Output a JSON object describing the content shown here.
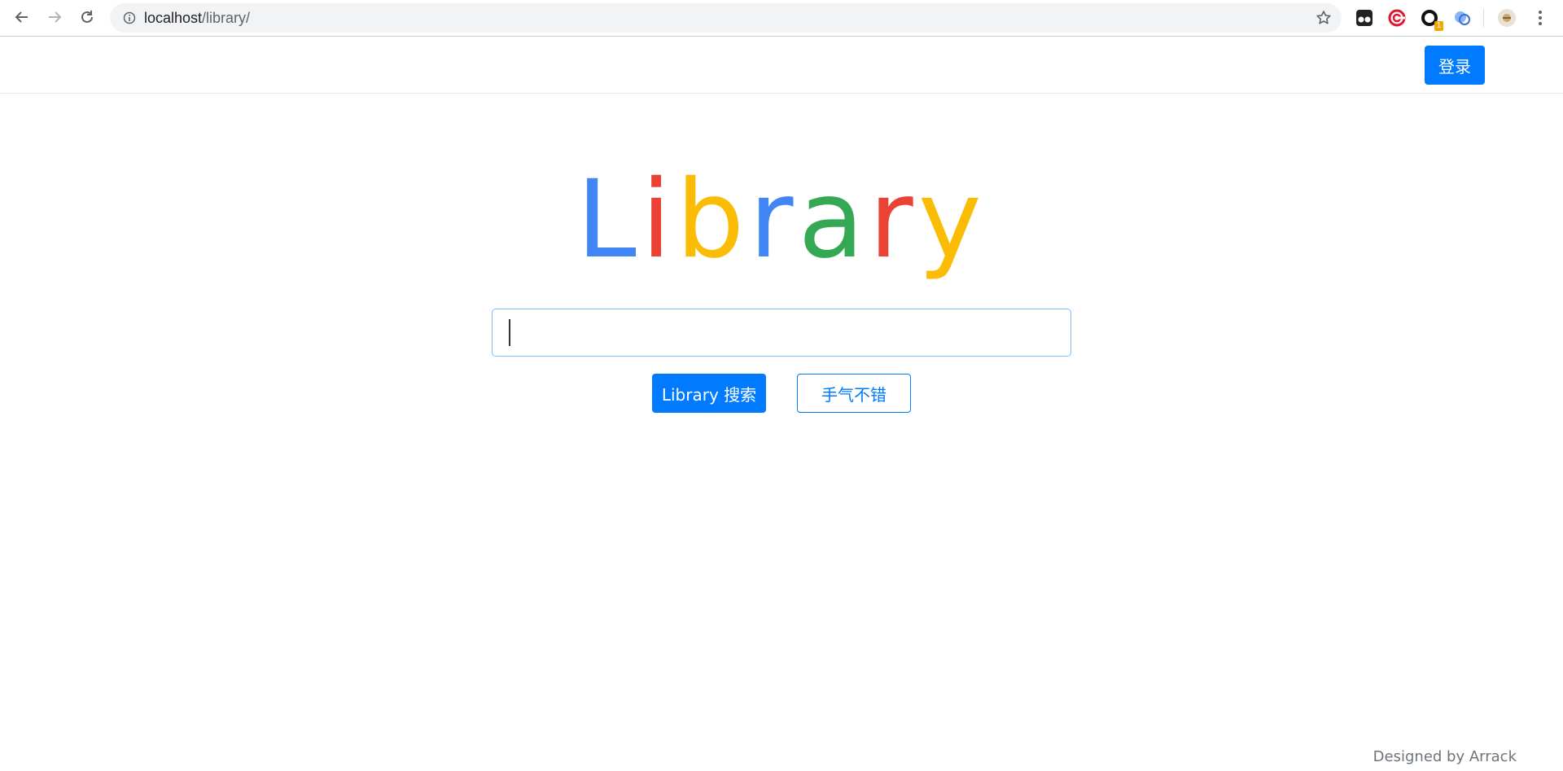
{
  "browser": {
    "url_host": "localhost",
    "url_path": "/library/",
    "extensions": [
      "tampermonkey-icon",
      "target-icon",
      "ring-icon",
      "translate-icon",
      "avatar-icon"
    ],
    "extension_badge": "1"
  },
  "navbar": {
    "login_label": "登录"
  },
  "logo": {
    "letters": [
      {
        "char": "L",
        "color": "#4285f4"
      },
      {
        "char": "i",
        "color": "#ea4335"
      },
      {
        "char": "b",
        "color": "#fbbc05"
      },
      {
        "char": "r",
        "color": "#4285f4"
      },
      {
        "char": "a",
        "color": "#34a853"
      },
      {
        "char": "r",
        "color": "#ea4335"
      },
      {
        "char": "y",
        "color": "#fbbc05"
      }
    ]
  },
  "search": {
    "value": "",
    "placeholder": "",
    "search_button_label": "Library 搜索",
    "lucky_button_label": "手气不错"
  },
  "footer": {
    "text": "Designed by Arrack"
  },
  "colors": {
    "primary": "#007bff",
    "focus_border": "#80bdff"
  }
}
